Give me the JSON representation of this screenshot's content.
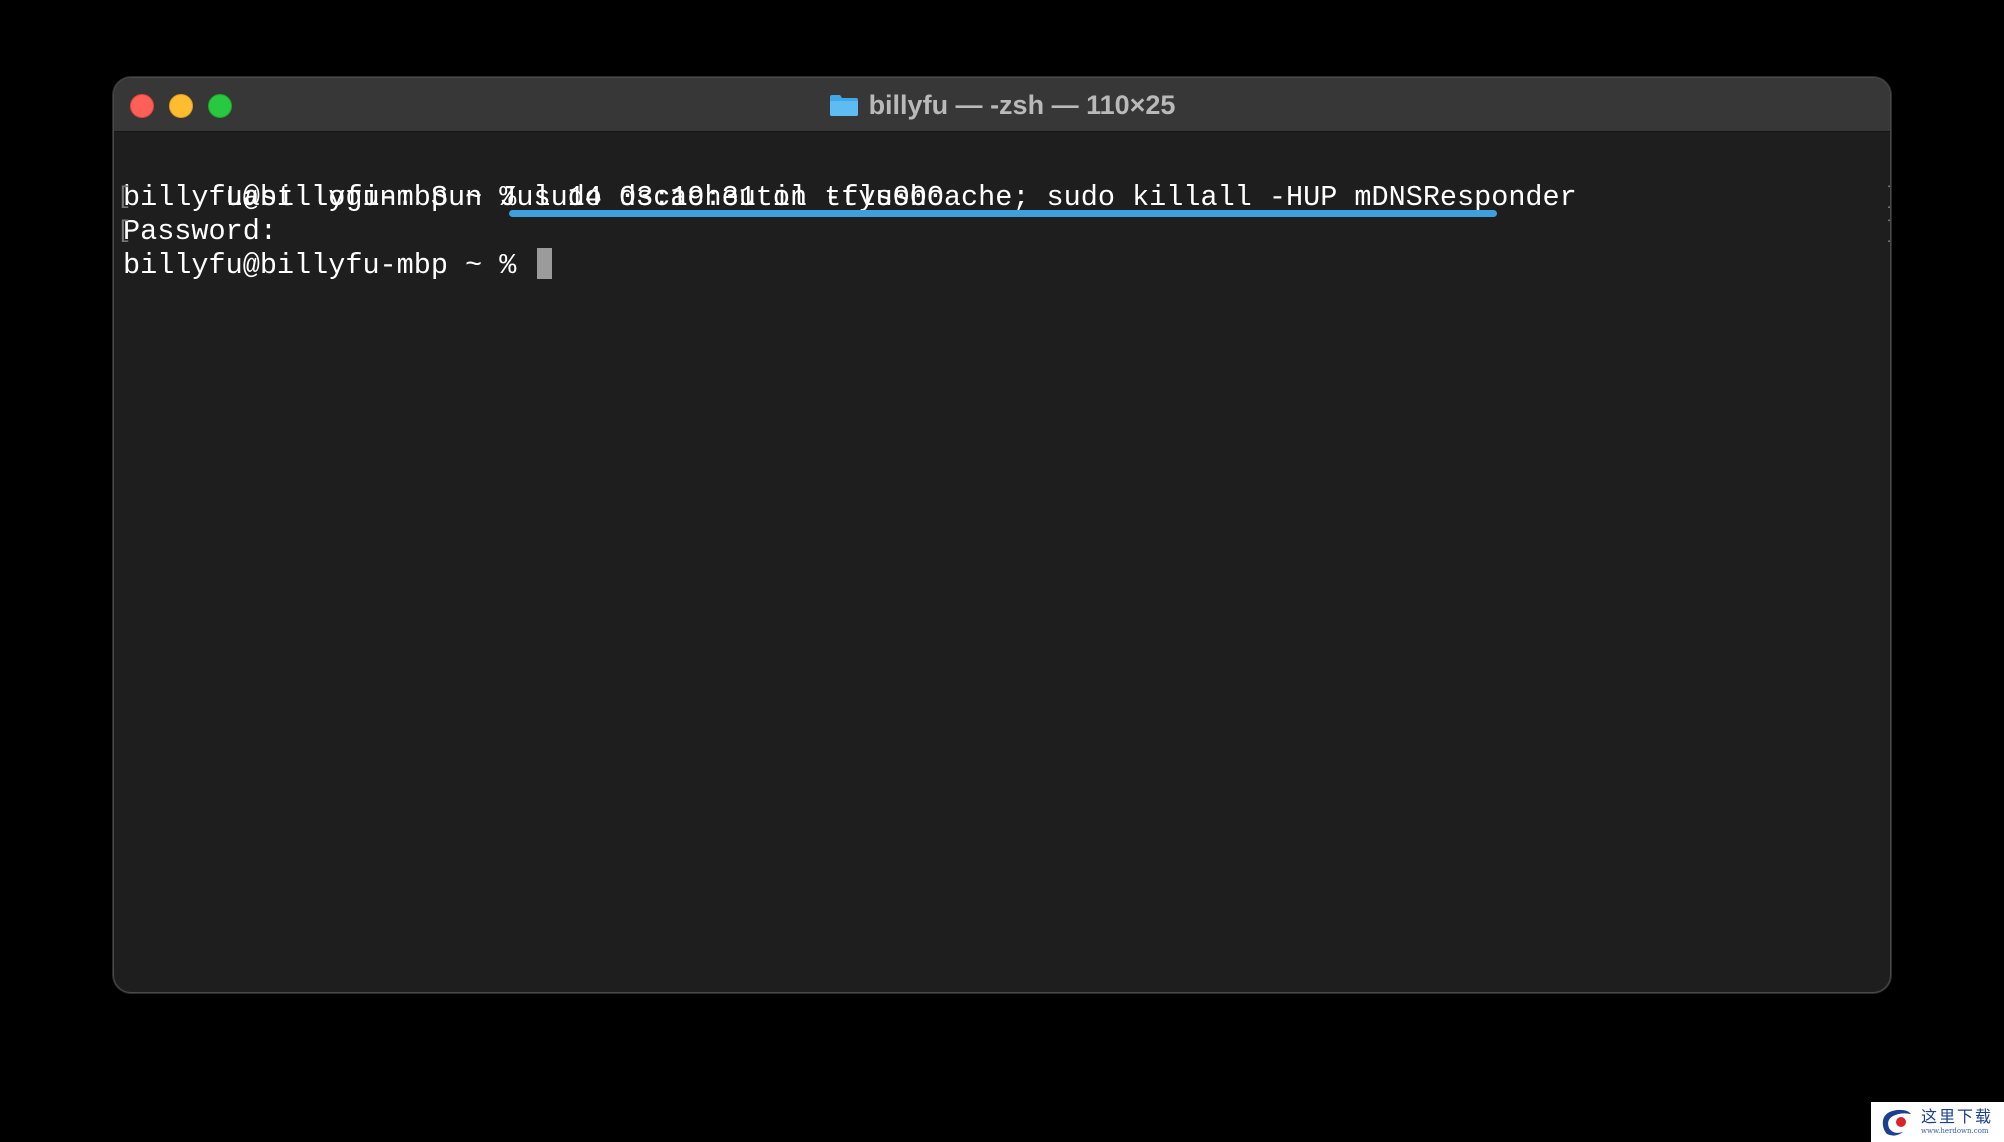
{
  "window": {
    "title": "billyfu — -zsh — 110×25",
    "title_icon": "folder-icon",
    "traffic_lights": [
      "close",
      "minimize",
      "zoom"
    ]
  },
  "terminal": {
    "lines": [
      {
        "text": "Last login: Sun Jul 14 03:19:31 on ttys000"
      },
      {
        "prompt": "billyfu@billyfu-mbp ~ % ",
        "command": "sudo dscacheutil -flushcache; sudo killall -HUP mDNSResponder"
      },
      {
        "text": "Password:"
      },
      {
        "prompt": "billyfu@billyfu-mbp ~ % "
      }
    ],
    "highlight_color": "#3d9fdc"
  },
  "watermark": {
    "title": "这里下载",
    "url": "www.herdown.com"
  }
}
